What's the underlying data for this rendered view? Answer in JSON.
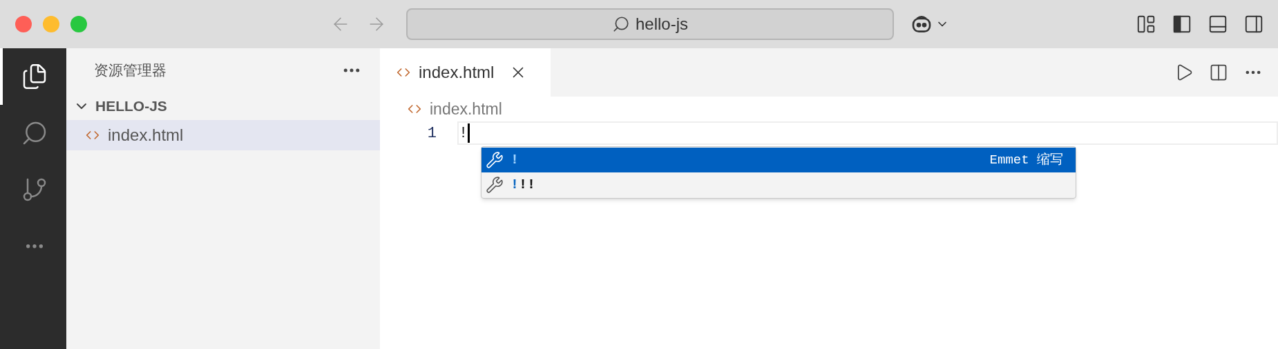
{
  "title_bar": {
    "search": "hello-js"
  },
  "activity_bar": [
    {
      "kind": "files",
      "selected": true
    },
    {
      "kind": "search",
      "selected": false
    },
    {
      "kind": "source-control",
      "selected": false
    },
    {
      "kind": "more",
      "selected": false
    }
  ],
  "sidebar": {
    "title": "资源管理器",
    "folder": {
      "name": "HELLO-JS",
      "expanded": true,
      "children": [
        {
          "name": "index.html",
          "selected": true
        }
      ]
    }
  },
  "tabs": [
    {
      "label": "index.html",
      "selected": true
    }
  ],
  "breadcrumb": "index.html",
  "editor": {
    "lines": [
      {
        "number": "1",
        "text": "!"
      }
    ]
  },
  "suggestions": [
    {
      "match": "!",
      "detail": "Emmet 缩写",
      "selected": true
    },
    {
      "match": "!",
      "rest": "!!",
      "selected": false
    }
  ]
}
